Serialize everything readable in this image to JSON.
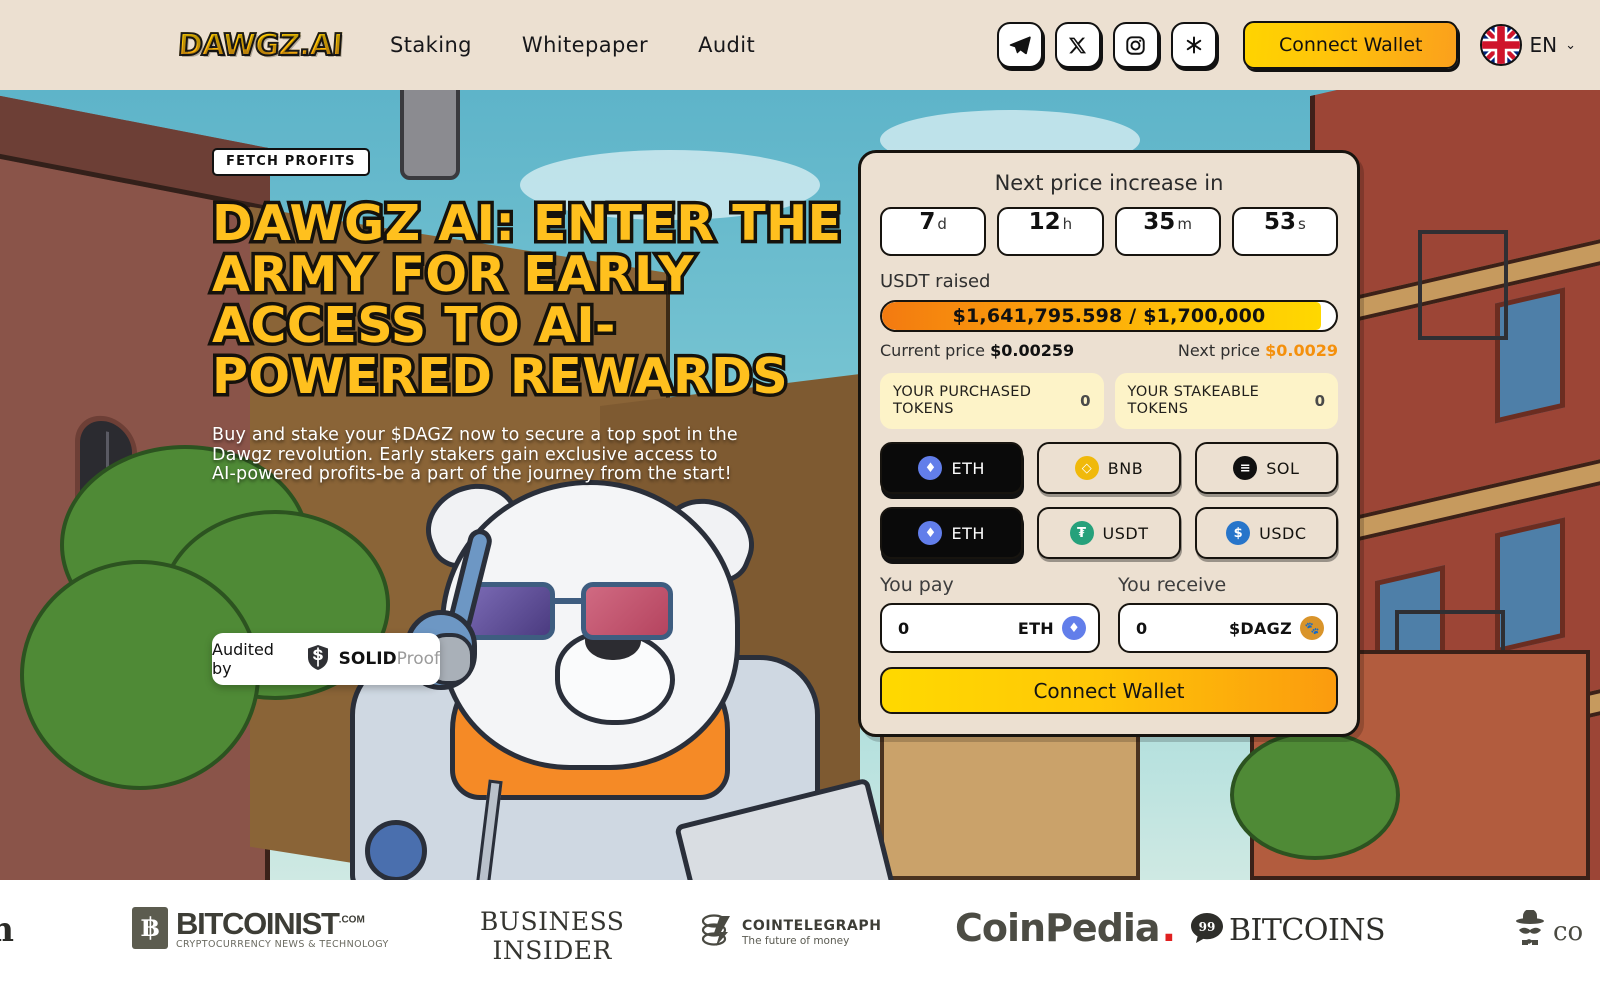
{
  "header": {
    "logo": "DAWGZ.AI",
    "nav": [
      {
        "label": "Staking"
      },
      {
        "label": "Whitepaper"
      },
      {
        "label": "Audit"
      }
    ],
    "social": [
      {
        "name": "telegram-icon"
      },
      {
        "name": "x-twitter-icon"
      },
      {
        "name": "instagram-icon"
      },
      {
        "name": "linktree-icon"
      }
    ],
    "connect_wallet": "Connect Wallet",
    "language": "EN",
    "language_chevron": "⌄"
  },
  "hero": {
    "badge": "FETCH PROFITS",
    "title": "DAWGZ AI: ENTER THE ARMY FOR EARLY ACCESS TO AI-POWERED REWARDS",
    "subtitle": "Buy and stake your $DAGZ now to secure a top spot in the Dawgz revolution. Early stakers gain exclusive access to AI-powered profits-be a part of the journey from the start!",
    "audit_label": "Audited by",
    "audit_brand_bold": "SOLID",
    "audit_brand_light": "Proof"
  },
  "widget": {
    "countdown_title": "Next price increase in",
    "countdown": [
      {
        "value": "7",
        "unit": "d"
      },
      {
        "value": "12",
        "unit": "h"
      },
      {
        "value": "35",
        "unit": "m"
      },
      {
        "value": "53",
        "unit": "s"
      }
    ],
    "raised_label": "USDT raised",
    "progress_text": "$1,641,795.598 / $1,700,000",
    "progress_percent": 96.6,
    "current_price_label": "Current price",
    "current_price_value": "$0.00259",
    "next_price_label": "Next price",
    "next_price_value": "$0.0029",
    "stats": [
      {
        "label": "YOUR PURCHASED TOKENS",
        "value": "0"
      },
      {
        "label": "YOUR STAKEABLE TOKENS",
        "value": "0"
      }
    ],
    "chains_row1": [
      {
        "label": "ETH",
        "symbol": "♦",
        "color": "#627eea",
        "selected": true
      },
      {
        "label": "BNB",
        "symbol": "◇",
        "color": "#f0b90b",
        "selected": false
      },
      {
        "label": "SOL",
        "symbol": "≡",
        "color": "#101010",
        "selected": false
      }
    ],
    "chains_row2": [
      {
        "label": "ETH",
        "symbol": "♦",
        "color": "#627eea",
        "selected": true
      },
      {
        "label": "USDT",
        "symbol": "₮",
        "color": "#26a17b",
        "selected": false
      },
      {
        "label": "USDC",
        "symbol": "$",
        "color": "#2775ca",
        "selected": false
      }
    ],
    "pay_label": "You pay",
    "receive_label": "You receive",
    "pay_value": "0",
    "pay_placeholder": "0",
    "pay_unit": "ETH",
    "receive_value": "0",
    "receive_placeholder": "0",
    "receive_unit": "$DAGZ",
    "cta": "Connect Wallet"
  },
  "press": [
    {
      "name": "bitcoinist",
      "title": "BITCOINIST",
      "sup": ".COM",
      "tagline": "CRYPTOCURRENCY NEWS & TECHNOLOGY",
      "mark": "฿"
    },
    {
      "name": "business-insider",
      "line1": "BUSINESS",
      "line2": "INSIDER"
    },
    {
      "name": "cointelegraph",
      "title": "COINTELEGRAPH",
      "tagline": "The future of money"
    },
    {
      "name": "coinpedia",
      "title": "CoinPedia",
      "dot": "."
    },
    {
      "name": "99bitcoins",
      "mark": "99",
      "title": "BITCOINS"
    },
    {
      "name": "cut-left-logo",
      "title": "m"
    },
    {
      "name": "coinspeaker",
      "title": "co"
    }
  ],
  "colors": {
    "brand_yellow": "#ffc01e",
    "brand_orange": "#f4900c",
    "header_bg": "#ece0d1",
    "panel_bg": "#ece0d1",
    "stat_bg": "#fdf3c8",
    "outline": "#17140f"
  }
}
